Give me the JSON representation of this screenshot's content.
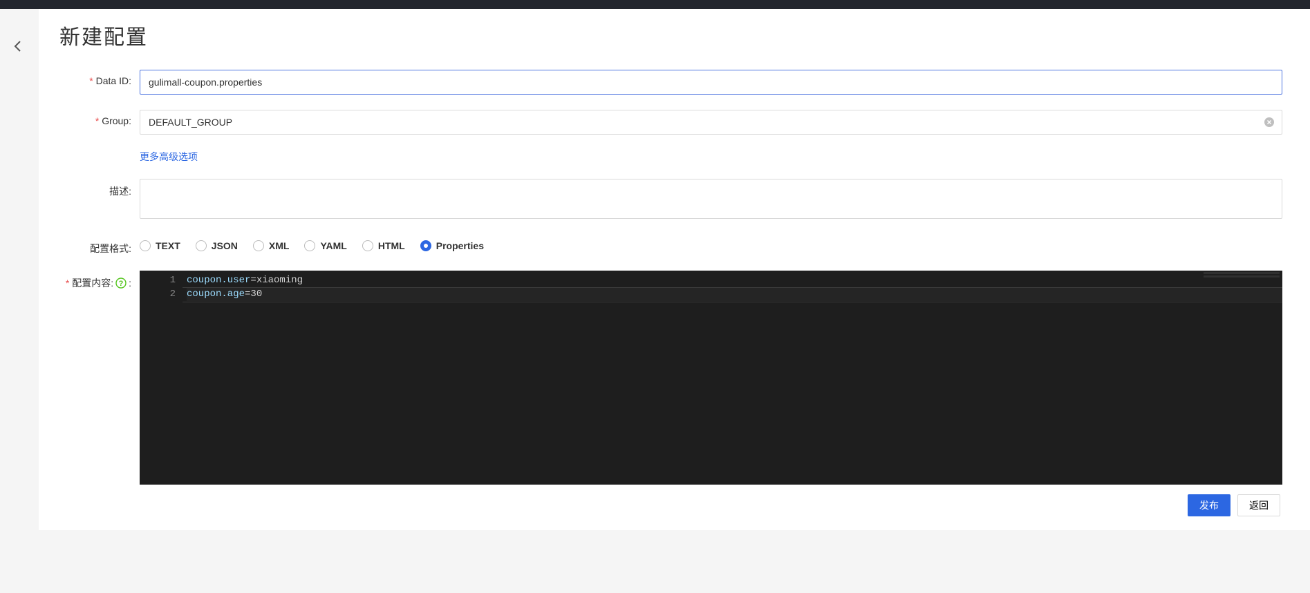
{
  "page_title": "新建配置",
  "labels": {
    "data_id": "Data ID:",
    "group": "Group:",
    "description": "描述:",
    "format": "配置格式:",
    "content": "配置内容:",
    "advanced": "更多高级选项"
  },
  "fields": {
    "data_id_value": "gulimall-coupon.properties",
    "group_value": "DEFAULT_GROUP",
    "description_value": ""
  },
  "format_options": [
    {
      "value": "TEXT",
      "label": "TEXT",
      "selected": false
    },
    {
      "value": "JSON",
      "label": "JSON",
      "selected": false
    },
    {
      "value": "XML",
      "label": "XML",
      "selected": false
    },
    {
      "value": "YAML",
      "label": "YAML",
      "selected": false
    },
    {
      "value": "HTML",
      "label": "HTML",
      "selected": false
    },
    {
      "value": "Properties",
      "label": "Properties",
      "selected": true
    }
  ],
  "content_lines": [
    {
      "num": "1",
      "key": "coupon.user",
      "value": "xiaoming"
    },
    {
      "num": "2",
      "key": "coupon.age",
      "value": "30"
    }
  ],
  "buttons": {
    "publish": "发布",
    "back": "返回"
  },
  "colors": {
    "primary": "#2c67e2",
    "required": "#e84d4d",
    "editor_bg": "#1e1e1e",
    "editor_key": "#9cdcfe"
  }
}
